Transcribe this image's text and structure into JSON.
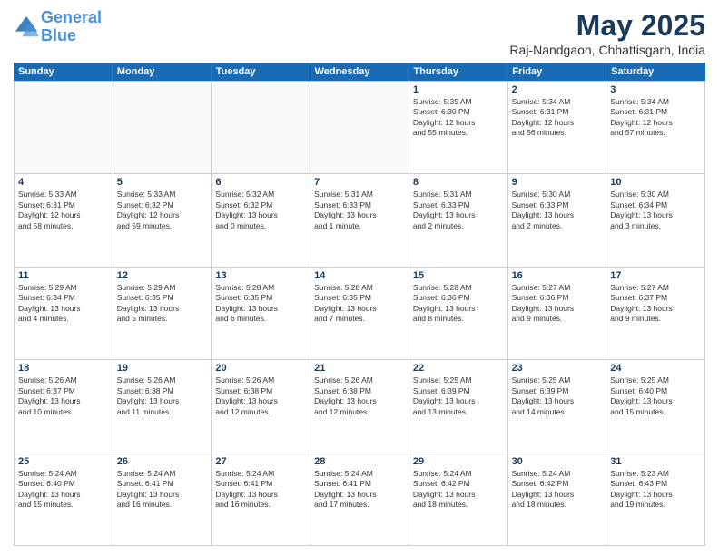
{
  "header": {
    "logo_line1": "General",
    "logo_line2": "Blue",
    "month_title": "May 2025",
    "location": "Raj-Nandgaon, Chhattisgarh, India"
  },
  "weekdays": [
    "Sunday",
    "Monday",
    "Tuesday",
    "Wednesday",
    "Thursday",
    "Friday",
    "Saturday"
  ],
  "rows": [
    [
      {
        "day": "",
        "info": "",
        "empty": true
      },
      {
        "day": "",
        "info": "",
        "empty": true
      },
      {
        "day": "",
        "info": "",
        "empty": true
      },
      {
        "day": "",
        "info": "",
        "empty": true
      },
      {
        "day": "1",
        "info": "Sunrise: 5:35 AM\nSunset: 6:30 PM\nDaylight: 12 hours\nand 55 minutes."
      },
      {
        "day": "2",
        "info": "Sunrise: 5:34 AM\nSunset: 6:31 PM\nDaylight: 12 hours\nand 56 minutes."
      },
      {
        "day": "3",
        "info": "Sunrise: 5:34 AM\nSunset: 6:31 PM\nDaylight: 12 hours\nand 57 minutes."
      }
    ],
    [
      {
        "day": "4",
        "info": "Sunrise: 5:33 AM\nSunset: 6:31 PM\nDaylight: 12 hours\nand 58 minutes."
      },
      {
        "day": "5",
        "info": "Sunrise: 5:33 AM\nSunset: 6:32 PM\nDaylight: 12 hours\nand 59 minutes."
      },
      {
        "day": "6",
        "info": "Sunrise: 5:32 AM\nSunset: 6:32 PM\nDaylight: 13 hours\nand 0 minutes."
      },
      {
        "day": "7",
        "info": "Sunrise: 5:31 AM\nSunset: 6:33 PM\nDaylight: 13 hours\nand 1 minute."
      },
      {
        "day": "8",
        "info": "Sunrise: 5:31 AM\nSunset: 6:33 PM\nDaylight: 13 hours\nand 2 minutes."
      },
      {
        "day": "9",
        "info": "Sunrise: 5:30 AM\nSunset: 6:33 PM\nDaylight: 13 hours\nand 2 minutes."
      },
      {
        "day": "10",
        "info": "Sunrise: 5:30 AM\nSunset: 6:34 PM\nDaylight: 13 hours\nand 3 minutes."
      }
    ],
    [
      {
        "day": "11",
        "info": "Sunrise: 5:29 AM\nSunset: 6:34 PM\nDaylight: 13 hours\nand 4 minutes."
      },
      {
        "day": "12",
        "info": "Sunrise: 5:29 AM\nSunset: 6:35 PM\nDaylight: 13 hours\nand 5 minutes."
      },
      {
        "day": "13",
        "info": "Sunrise: 5:28 AM\nSunset: 6:35 PM\nDaylight: 13 hours\nand 6 minutes."
      },
      {
        "day": "14",
        "info": "Sunrise: 5:28 AM\nSunset: 6:35 PM\nDaylight: 13 hours\nand 7 minutes."
      },
      {
        "day": "15",
        "info": "Sunrise: 5:28 AM\nSunset: 6:36 PM\nDaylight: 13 hours\nand 8 minutes."
      },
      {
        "day": "16",
        "info": "Sunrise: 5:27 AM\nSunset: 6:36 PM\nDaylight: 13 hours\nand 9 minutes."
      },
      {
        "day": "17",
        "info": "Sunrise: 5:27 AM\nSunset: 6:37 PM\nDaylight: 13 hours\nand 9 minutes."
      }
    ],
    [
      {
        "day": "18",
        "info": "Sunrise: 5:26 AM\nSunset: 6:37 PM\nDaylight: 13 hours\nand 10 minutes."
      },
      {
        "day": "19",
        "info": "Sunrise: 5:26 AM\nSunset: 6:38 PM\nDaylight: 13 hours\nand 11 minutes."
      },
      {
        "day": "20",
        "info": "Sunrise: 5:26 AM\nSunset: 6:38 PM\nDaylight: 13 hours\nand 12 minutes."
      },
      {
        "day": "21",
        "info": "Sunrise: 5:26 AM\nSunset: 6:38 PM\nDaylight: 13 hours\nand 12 minutes."
      },
      {
        "day": "22",
        "info": "Sunrise: 5:25 AM\nSunset: 6:39 PM\nDaylight: 13 hours\nand 13 minutes."
      },
      {
        "day": "23",
        "info": "Sunrise: 5:25 AM\nSunset: 6:39 PM\nDaylight: 13 hours\nand 14 minutes."
      },
      {
        "day": "24",
        "info": "Sunrise: 5:25 AM\nSunset: 6:40 PM\nDaylight: 13 hours\nand 15 minutes."
      }
    ],
    [
      {
        "day": "25",
        "info": "Sunrise: 5:24 AM\nSunset: 6:40 PM\nDaylight: 13 hours\nand 15 minutes."
      },
      {
        "day": "26",
        "info": "Sunrise: 5:24 AM\nSunset: 6:41 PM\nDaylight: 13 hours\nand 16 minutes."
      },
      {
        "day": "27",
        "info": "Sunrise: 5:24 AM\nSunset: 6:41 PM\nDaylight: 13 hours\nand 16 minutes."
      },
      {
        "day": "28",
        "info": "Sunrise: 5:24 AM\nSunset: 6:41 PM\nDaylight: 13 hours\nand 17 minutes."
      },
      {
        "day": "29",
        "info": "Sunrise: 5:24 AM\nSunset: 6:42 PM\nDaylight: 13 hours\nand 18 minutes."
      },
      {
        "day": "30",
        "info": "Sunrise: 5:24 AM\nSunset: 6:42 PM\nDaylight: 13 hours\nand 18 minutes."
      },
      {
        "day": "31",
        "info": "Sunrise: 5:23 AM\nSunset: 6:43 PM\nDaylight: 13 hours\nand 19 minutes."
      }
    ]
  ]
}
